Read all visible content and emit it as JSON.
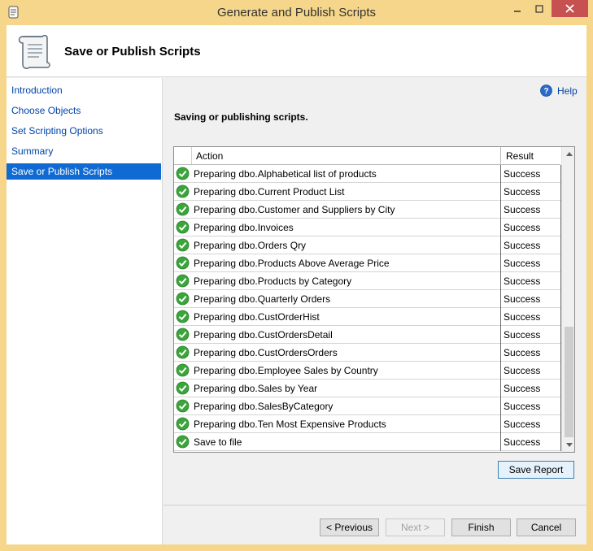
{
  "window": {
    "title": "Generate and Publish Scripts"
  },
  "header": {
    "title": "Save or Publish Scripts"
  },
  "nav": {
    "items": [
      {
        "label": "Introduction"
      },
      {
        "label": "Choose Objects"
      },
      {
        "label": "Set Scripting Options"
      },
      {
        "label": "Summary"
      },
      {
        "label": "Save or Publish Scripts",
        "active": true
      }
    ]
  },
  "help": {
    "label": "Help"
  },
  "main": {
    "section_title": "Saving or publishing scripts.",
    "grid": {
      "columns": [
        "Action",
        "Result"
      ],
      "rows": [
        {
          "action": "Preparing dbo.Alphabetical list of products",
          "result": "Success"
        },
        {
          "action": "Preparing dbo.Current Product List",
          "result": "Success"
        },
        {
          "action": "Preparing dbo.Customer and Suppliers by City",
          "result": "Success"
        },
        {
          "action": "Preparing dbo.Invoices",
          "result": "Success"
        },
        {
          "action": "Preparing dbo.Orders Qry",
          "result": "Success"
        },
        {
          "action": "Preparing dbo.Products Above Average Price",
          "result": "Success"
        },
        {
          "action": "Preparing dbo.Products by Category",
          "result": "Success"
        },
        {
          "action": "Preparing dbo.Quarterly Orders",
          "result": "Success"
        },
        {
          "action": "Preparing dbo.CustOrderHist",
          "result": "Success"
        },
        {
          "action": "Preparing dbo.CustOrdersDetail",
          "result": "Success"
        },
        {
          "action": "Preparing dbo.CustOrdersOrders",
          "result": "Success"
        },
        {
          "action": "Preparing dbo.Employee Sales by Country",
          "result": "Success"
        },
        {
          "action": "Preparing dbo.Sales by Year",
          "result": "Success"
        },
        {
          "action": "Preparing dbo.SalesByCategory",
          "result": "Success"
        },
        {
          "action": "Preparing dbo.Ten Most Expensive Products",
          "result": "Success"
        },
        {
          "action": "Save to file",
          "result": "Success"
        }
      ]
    },
    "save_report_label": "Save Report"
  },
  "footer": {
    "previous_label": "< Previous",
    "next_label": "Next >",
    "finish_label": "Finish",
    "cancel_label": "Cancel"
  },
  "icons": {
    "app": "scroll-icon",
    "header": "scroll-icon",
    "help": "help-icon",
    "status": "success-check-icon"
  },
  "colors": {
    "window_frame": "#f5d68a",
    "nav_active": "#0f6bd3",
    "link": "#0044aa",
    "success": "#3aa53a",
    "close_button": "#c75050"
  }
}
